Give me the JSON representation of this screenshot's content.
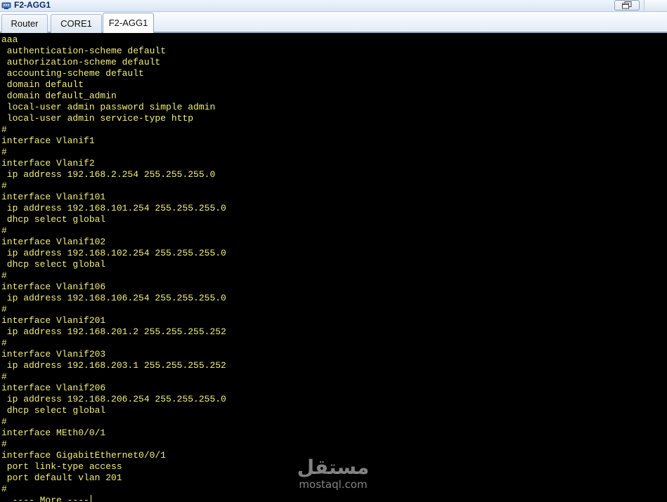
{
  "window": {
    "title": "F2-AGG1",
    "icon": "network-device-icon"
  },
  "tabs": [
    {
      "label": "Router",
      "active": false
    },
    {
      "label": "CORE1",
      "active": false
    },
    {
      "label": "F2-AGG1",
      "active": true
    }
  ],
  "terminal": {
    "text_color": "#f2ee78",
    "background": "#000000",
    "lines": [
      "aaa",
      " authentication-scheme default",
      " authorization-scheme default",
      " accounting-scheme default",
      " domain default",
      " domain default_admin",
      " local-user admin password simple admin",
      " local-user admin service-type http",
      "#",
      "interface Vlanif1",
      "#",
      "interface Vlanif2",
      " ip address 192.168.2.254 255.255.255.0",
      "#",
      "interface Vlanif101",
      " ip address 192.168.101.254 255.255.255.0",
      " dhcp select global",
      "#",
      "interface Vlanif102",
      " ip address 192.168.102.254 255.255.255.0",
      " dhcp select global",
      "#",
      "interface Vlanif106",
      " ip address 192.168.106.254 255.255.255.0",
      "#",
      "interface Vlanif201",
      " ip address 192.168.201.2 255.255.255.252",
      "#",
      "interface Vlanif203",
      " ip address 192.168.203.1 255.255.255.252",
      "#",
      "interface Vlanif206",
      " ip address 192.168.206.254 255.255.255.0",
      " dhcp select global",
      "#",
      "interface MEth0/0/1",
      "#",
      "interface GigabitEthernet0/0/1",
      " port link-type access",
      " port default vlan 201",
      "#",
      "  ---- More ----"
    ]
  },
  "watermark": {
    "logo": "مستقل",
    "text": "mostaql.com"
  }
}
